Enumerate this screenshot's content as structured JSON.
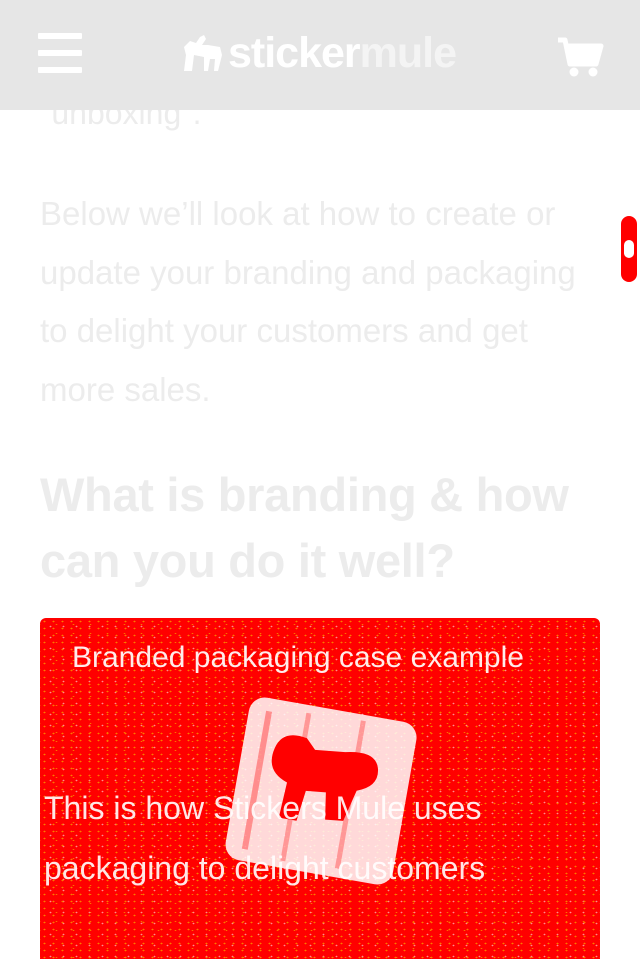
{
  "header": {
    "brand_part1": "sticker",
    "brand_part2": "mule"
  },
  "article": {
    "partial_line": "\"unboxing\".",
    "paragraph": "Below we’ll look at how to create or update your branding and packaging to delight your customers and get more sales.",
    "heading": "What is branding & how can you do it well?",
    "card": {
      "title": "Branded packaging case example",
      "body": "This is how Stickers Mule uses packaging to delight customers"
    }
  },
  "colors": {
    "header_bg": "#e6e6e6",
    "accent": "#ff0000",
    "text_faint": "#ececec"
  },
  "icons": [
    "menu-icon",
    "mule-logo-icon",
    "cart-icon",
    "mascot-icon"
  ]
}
